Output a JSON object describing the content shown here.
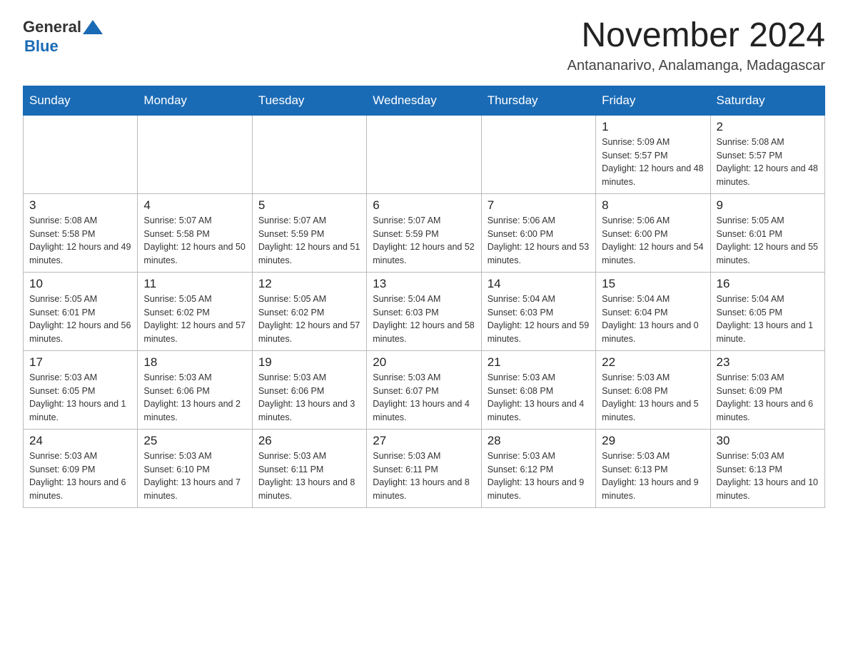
{
  "logo": {
    "general": "General",
    "blue": "Blue"
  },
  "title": "November 2024",
  "subtitle": "Antananarivo, Analamanga, Madagascar",
  "weekdays": [
    "Sunday",
    "Monday",
    "Tuesday",
    "Wednesday",
    "Thursday",
    "Friday",
    "Saturday"
  ],
  "weeks": [
    [
      {
        "day": "",
        "info": ""
      },
      {
        "day": "",
        "info": ""
      },
      {
        "day": "",
        "info": ""
      },
      {
        "day": "",
        "info": ""
      },
      {
        "day": "",
        "info": ""
      },
      {
        "day": "1",
        "info": "Sunrise: 5:09 AM\nSunset: 5:57 PM\nDaylight: 12 hours and 48 minutes."
      },
      {
        "day": "2",
        "info": "Sunrise: 5:08 AM\nSunset: 5:57 PM\nDaylight: 12 hours and 48 minutes."
      }
    ],
    [
      {
        "day": "3",
        "info": "Sunrise: 5:08 AM\nSunset: 5:58 PM\nDaylight: 12 hours and 49 minutes."
      },
      {
        "day": "4",
        "info": "Sunrise: 5:07 AM\nSunset: 5:58 PM\nDaylight: 12 hours and 50 minutes."
      },
      {
        "day": "5",
        "info": "Sunrise: 5:07 AM\nSunset: 5:59 PM\nDaylight: 12 hours and 51 minutes."
      },
      {
        "day": "6",
        "info": "Sunrise: 5:07 AM\nSunset: 5:59 PM\nDaylight: 12 hours and 52 minutes."
      },
      {
        "day": "7",
        "info": "Sunrise: 5:06 AM\nSunset: 6:00 PM\nDaylight: 12 hours and 53 minutes."
      },
      {
        "day": "8",
        "info": "Sunrise: 5:06 AM\nSunset: 6:00 PM\nDaylight: 12 hours and 54 minutes."
      },
      {
        "day": "9",
        "info": "Sunrise: 5:05 AM\nSunset: 6:01 PM\nDaylight: 12 hours and 55 minutes."
      }
    ],
    [
      {
        "day": "10",
        "info": "Sunrise: 5:05 AM\nSunset: 6:01 PM\nDaylight: 12 hours and 56 minutes."
      },
      {
        "day": "11",
        "info": "Sunrise: 5:05 AM\nSunset: 6:02 PM\nDaylight: 12 hours and 57 minutes."
      },
      {
        "day": "12",
        "info": "Sunrise: 5:05 AM\nSunset: 6:02 PM\nDaylight: 12 hours and 57 minutes."
      },
      {
        "day": "13",
        "info": "Sunrise: 5:04 AM\nSunset: 6:03 PM\nDaylight: 12 hours and 58 minutes."
      },
      {
        "day": "14",
        "info": "Sunrise: 5:04 AM\nSunset: 6:03 PM\nDaylight: 12 hours and 59 minutes."
      },
      {
        "day": "15",
        "info": "Sunrise: 5:04 AM\nSunset: 6:04 PM\nDaylight: 13 hours and 0 minutes."
      },
      {
        "day": "16",
        "info": "Sunrise: 5:04 AM\nSunset: 6:05 PM\nDaylight: 13 hours and 1 minute."
      }
    ],
    [
      {
        "day": "17",
        "info": "Sunrise: 5:03 AM\nSunset: 6:05 PM\nDaylight: 13 hours and 1 minute."
      },
      {
        "day": "18",
        "info": "Sunrise: 5:03 AM\nSunset: 6:06 PM\nDaylight: 13 hours and 2 minutes."
      },
      {
        "day": "19",
        "info": "Sunrise: 5:03 AM\nSunset: 6:06 PM\nDaylight: 13 hours and 3 minutes."
      },
      {
        "day": "20",
        "info": "Sunrise: 5:03 AM\nSunset: 6:07 PM\nDaylight: 13 hours and 4 minutes."
      },
      {
        "day": "21",
        "info": "Sunrise: 5:03 AM\nSunset: 6:08 PM\nDaylight: 13 hours and 4 minutes."
      },
      {
        "day": "22",
        "info": "Sunrise: 5:03 AM\nSunset: 6:08 PM\nDaylight: 13 hours and 5 minutes."
      },
      {
        "day": "23",
        "info": "Sunrise: 5:03 AM\nSunset: 6:09 PM\nDaylight: 13 hours and 6 minutes."
      }
    ],
    [
      {
        "day": "24",
        "info": "Sunrise: 5:03 AM\nSunset: 6:09 PM\nDaylight: 13 hours and 6 minutes."
      },
      {
        "day": "25",
        "info": "Sunrise: 5:03 AM\nSunset: 6:10 PM\nDaylight: 13 hours and 7 minutes."
      },
      {
        "day": "26",
        "info": "Sunrise: 5:03 AM\nSunset: 6:11 PM\nDaylight: 13 hours and 8 minutes."
      },
      {
        "day": "27",
        "info": "Sunrise: 5:03 AM\nSunset: 6:11 PM\nDaylight: 13 hours and 8 minutes."
      },
      {
        "day": "28",
        "info": "Sunrise: 5:03 AM\nSunset: 6:12 PM\nDaylight: 13 hours and 9 minutes."
      },
      {
        "day": "29",
        "info": "Sunrise: 5:03 AM\nSunset: 6:13 PM\nDaylight: 13 hours and 9 minutes."
      },
      {
        "day": "30",
        "info": "Sunrise: 5:03 AM\nSunset: 6:13 PM\nDaylight: 13 hours and 10 minutes."
      }
    ]
  ]
}
